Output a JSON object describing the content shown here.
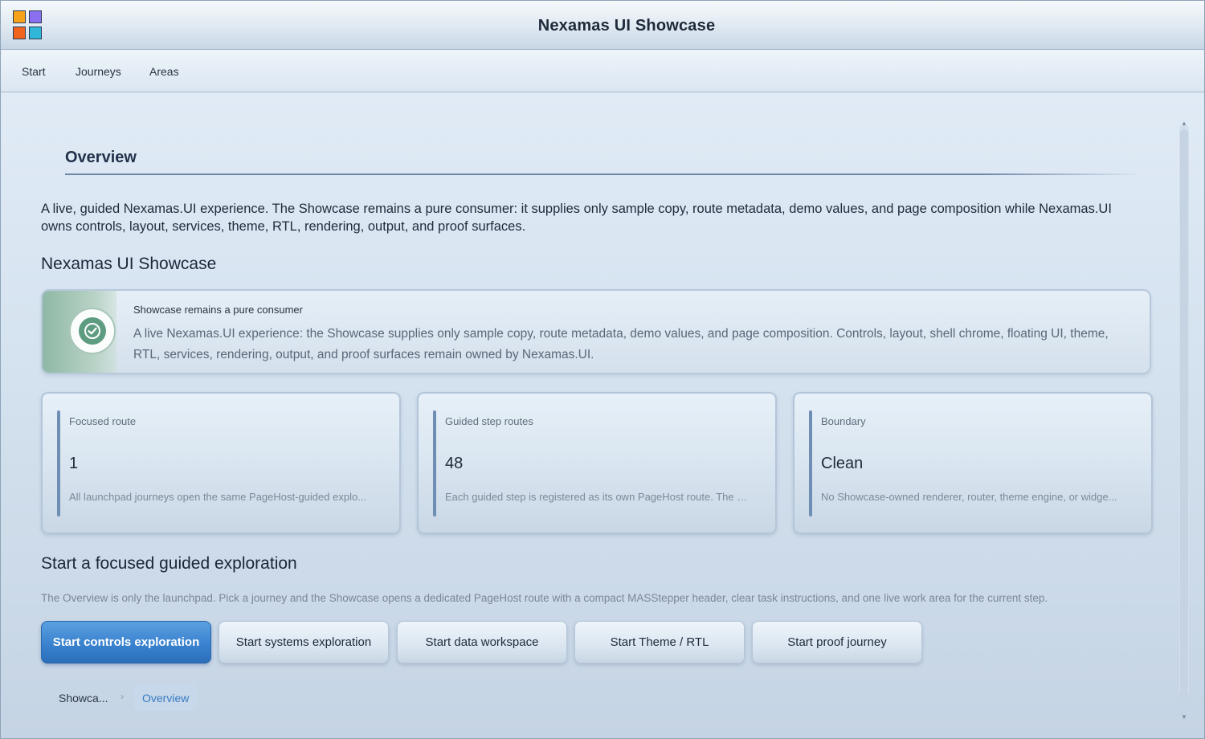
{
  "window": {
    "title": "Nexamas UI Showcase"
  },
  "menu": {
    "items": [
      {
        "label": "Start"
      },
      {
        "label": "Journeys"
      },
      {
        "label": "Areas"
      }
    ]
  },
  "overview": {
    "section_title": "Overview",
    "intro": "A live, guided Nexamas.UI experience. The Showcase remains a pure consumer: it supplies only sample copy, route metadata, demo values, and page composition while Nexamas.UI owns controls, layout, services, theme, RTL, rendering, output, and proof surfaces.",
    "heading": "Nexamas UI Showcase",
    "callout": {
      "icon": "check-circle-icon",
      "title": "Showcase remains a pure consumer",
      "body": "A live Nexamas.UI experience: the Showcase supplies only sample copy, route metadata, demo values, and page composition. Controls, layout, shell chrome, floating UI, theme, RTL, services, rendering, output, and proof surfaces remain owned by Nexamas.UI."
    },
    "stats": [
      {
        "label": "Focused route",
        "value": "1",
        "description": "All launchpad journeys open the same PageHost-guided explo..."
      },
      {
        "label": "Guided step routes",
        "value": "48",
        "description": "Each guided step is registered as its own PageHost route. The c..."
      },
      {
        "label": "Boundary",
        "value": "Clean",
        "description": "No Showcase-owned renderer, router, theme engine, or widge..."
      }
    ]
  },
  "exploration": {
    "heading": "Start a focused guided exploration",
    "helper": "The Overview is only the launchpad. Pick a journey and the Showcase opens a dedicated PageHost route with a compact MASStepper header, clear task instructions, and one live work area for the current step.",
    "buttons": [
      {
        "label": "Start controls exploration",
        "primary": true
      },
      {
        "label": "Start systems exploration",
        "primary": false
      },
      {
        "label": "Start data workspace",
        "primary": false
      },
      {
        "label": "Start Theme / RTL",
        "primary": false
      },
      {
        "label": "Start proof journey",
        "primary": false
      }
    ]
  },
  "breadcrumb": {
    "root": "Showca...",
    "separator": "›",
    "current": "Overview"
  },
  "colors": {
    "accent": "#3a82cf",
    "success": "#5e9c82"
  }
}
